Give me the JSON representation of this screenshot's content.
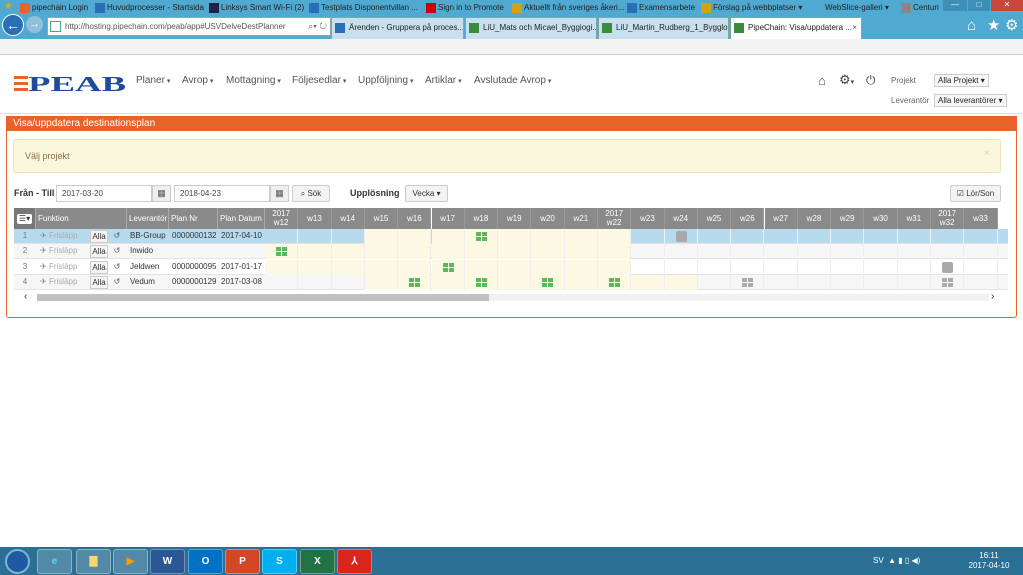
{
  "browser": {
    "url": "http://hosting.pipechain.com/peab/app#USVDelveDestPlanner",
    "tabs": [
      {
        "label": "Ärenden - Gruppera på proces...",
        "active": false
      },
      {
        "label": "LiU_Mats och Micael_Byggiogi...",
        "active": false
      },
      {
        "label": "LiU_Martin_Rudberg_1_Bygglo...",
        "active": false
      },
      {
        "label": "PipeChain: Visa/uppdatera ...",
        "active": true
      }
    ],
    "favorites": [
      "pipechain Login",
      "Huvudprocesser - Startsida",
      "Linksys Smart Wi-Fi (2)",
      "Testplats Disponentvillan ...",
      "Sign in to Promote",
      "Aktuellt från sveriges åkeri...",
      "Examensarbete",
      "Förslag på webbplatser ▾",
      "WebSlice-galleri ▾",
      "Centuri"
    ]
  },
  "app": {
    "logo": "PEAB",
    "menu": [
      "Planer",
      "Avrop",
      "Mottagning",
      "Följesedlar",
      "Uppföljning",
      "Artiklar",
      "Avslutade Avrop"
    ],
    "project_label": "Projekt",
    "project_value": "Alla Projekt",
    "supplier_label": "Leverantör",
    "supplier_value": "Alla leverantörer"
  },
  "panel": {
    "title": "Visa/uppdatera destinationsplan",
    "alert": "Välj projekt",
    "alert_close": "×",
    "range_label": "Från - Till",
    "from": "2017-03-20",
    "to": "2018-04-23",
    "search_label": "Sök",
    "resolution_label": "Upplösning",
    "resolution_value": "Vecka",
    "weekend_label": "Lör/Son"
  },
  "grid": {
    "columns": {
      "function": "Funktion",
      "supplier": "Leverantör",
      "plan_nr": "Plan Nr",
      "plan_date": "Plan Datum"
    },
    "weeks": [
      {
        "yr": "2017",
        "wn": "w12"
      },
      {
        "yr": "",
        "wn": "w13"
      },
      {
        "yr": "",
        "wn": "w14"
      },
      {
        "yr": "",
        "wn": "w15"
      },
      {
        "yr": "",
        "wn": "w16"
      },
      {
        "yr": "",
        "wn": "w17"
      },
      {
        "yr": "",
        "wn": "w18"
      },
      {
        "yr": "",
        "wn": "w19"
      },
      {
        "yr": "",
        "wn": "w20"
      },
      {
        "yr": "",
        "wn": "w21"
      },
      {
        "yr": "2017",
        "wn": "w22"
      },
      {
        "yr": "",
        "wn": "w23"
      },
      {
        "yr": "",
        "wn": "w24"
      },
      {
        "yr": "",
        "wn": "w25"
      },
      {
        "yr": "",
        "wn": "w26"
      },
      {
        "yr": "",
        "wn": "w27"
      },
      {
        "yr": "",
        "wn": "w28"
      },
      {
        "yr": "",
        "wn": "w29"
      },
      {
        "yr": "",
        "wn": "w30"
      },
      {
        "yr": "",
        "wn": "w31"
      },
      {
        "yr": "2017",
        "wn": "w32"
      },
      {
        "yr": "",
        "wn": "w33"
      }
    ],
    "rows": [
      {
        "n": "1",
        "release": "Frisläpp",
        "all": "Alla",
        "supplier": "BB-Group",
        "plan_nr": "0000000132",
        "plan_date": "2017-04-10"
      },
      {
        "n": "2",
        "release": "Frisläpp",
        "all": "Alla",
        "supplier": "Inwido",
        "plan_nr": "",
        "plan_date": ""
      },
      {
        "n": "3",
        "release": "Frisläpp",
        "all": "Alla",
        "supplier": "Jeldwen",
        "plan_nr": "0000000095",
        "plan_date": "2017-01-17"
      },
      {
        "n": "4",
        "release": "Frisläpp",
        "all": "Alla",
        "supplier": "Vedum",
        "plan_nr": "0000000129",
        "plan_date": "2017-03-08"
      }
    ],
    "markers": [
      {
        "row": 0,
        "week": "w18",
        "kind": "green"
      },
      {
        "row": 0,
        "week": "w24",
        "kind": "gray"
      },
      {
        "row": 1,
        "week": "w12",
        "kind": "green"
      },
      {
        "row": 2,
        "week": "w17",
        "kind": "green"
      },
      {
        "row": 2,
        "week": "w32",
        "kind": "gray"
      },
      {
        "row": 3,
        "week": "w16",
        "kind": "green"
      },
      {
        "row": 3,
        "week": "w18",
        "kind": "green"
      },
      {
        "row": 3,
        "week": "w20",
        "kind": "green"
      },
      {
        "row": 3,
        "week": "w22",
        "kind": "green"
      },
      {
        "row": 3,
        "week": "w26",
        "kind": "gray-grid"
      },
      {
        "row": 3,
        "week": "w32",
        "kind": "gray-grid"
      }
    ],
    "colors": {
      "selected_row": "#b8daef",
      "planned_period": "#fcf8e3",
      "marker_green": "#5cb85c",
      "marker_gray": "#a9a9a9",
      "header_bg": "#8a8a8a",
      "accent": "#e8632a"
    }
  },
  "taskbar": {
    "apps": [
      "IE",
      "Explorer",
      "Media",
      "W",
      "O",
      "P",
      "S",
      "X",
      "PDF"
    ],
    "lang": "SV",
    "time": "16:11",
    "date": "2017-04-10"
  }
}
